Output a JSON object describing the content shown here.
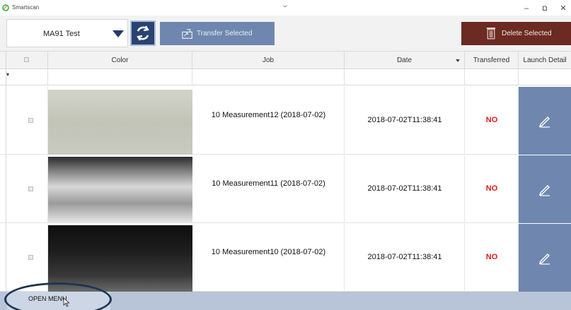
{
  "window": {
    "title": "Smartscan",
    "minimize_glyph": "–",
    "maximize_glyph": "ם",
    "close_glyph": "✕",
    "collapse_glyph": "⌄"
  },
  "toolbar": {
    "device_select": {
      "value": "MA91 Test"
    },
    "refresh_icon": "refresh-icon",
    "transfer_label": "Transfer Selected",
    "delete_label": "Delete Selected"
  },
  "table": {
    "columns": [
      "",
      "Color",
      "Job",
      "Date",
      "Transferred",
      "Launch Detail"
    ],
    "rows": [
      {
        "job": "10 Measurement12 (2018-07-02)",
        "date": "2018-07-02T11:38:41",
        "transferred": "NO",
        "color": "light-gray"
      },
      {
        "job": "10 Measurement11 (2018-07-02)",
        "date": "2018-07-02T11:38:41",
        "transferred": "NO",
        "color": "silver-gradient"
      },
      {
        "job": "10 Measurement10 (2018-07-02)",
        "date": "2018-07-02T11:38:41",
        "transferred": "NO",
        "color": "black-gradient"
      }
    ]
  },
  "footer": {
    "open_menu_label": "OPEN MENU"
  },
  "colors": {
    "accent_blue": "#6f87af",
    "dark_blue": "#2a4373",
    "delete_red": "#6b2a22",
    "status_no": "#e01b1b"
  }
}
